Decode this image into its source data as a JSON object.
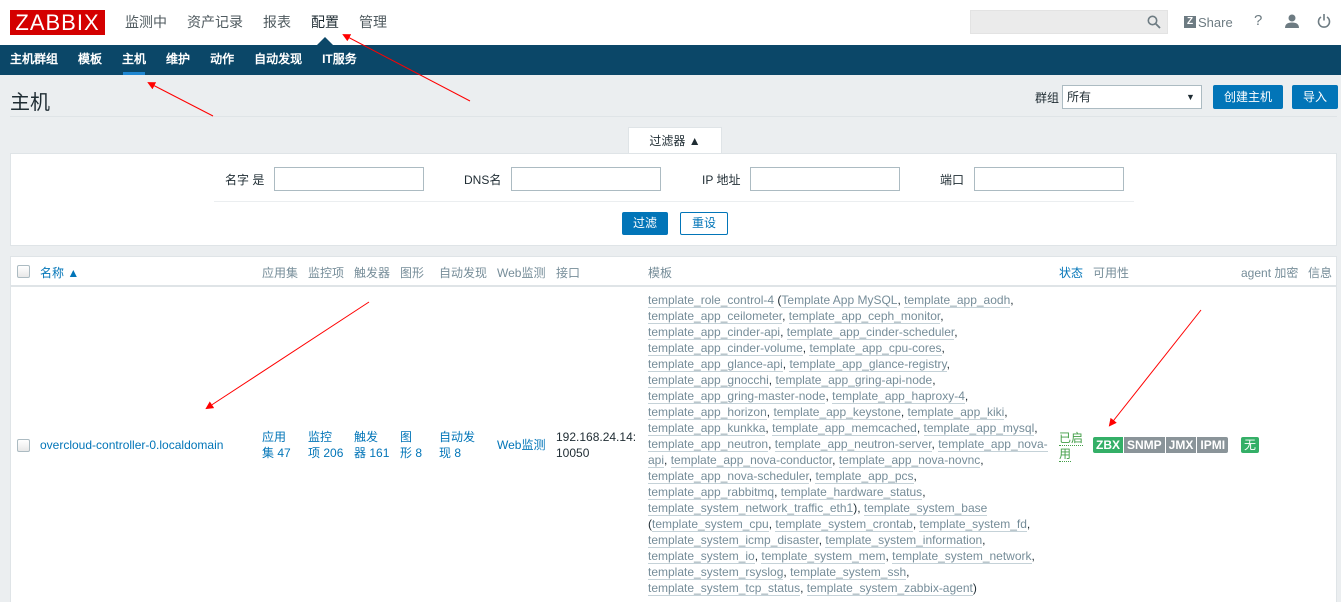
{
  "header": {
    "logo": "ZABBIX",
    "main_menu": [
      {
        "label": "监测中",
        "active": false
      },
      {
        "label": "资产记录",
        "active": false
      },
      {
        "label": "报表",
        "active": false
      },
      {
        "label": "配置",
        "active": true
      },
      {
        "label": "管理",
        "active": false
      }
    ],
    "search": {
      "value": "",
      "placeholder": ""
    },
    "share_label": "Share",
    "share_icon_letter": "Z",
    "help_label": "?"
  },
  "sub_menu": [
    {
      "label": "主机群组",
      "active": false
    },
    {
      "label": "模板",
      "active": false
    },
    {
      "label": "主机",
      "active": true
    },
    {
      "label": "维护",
      "active": false
    },
    {
      "label": "动作",
      "active": false
    },
    {
      "label": "自动发现",
      "active": false
    },
    {
      "label": "IT服务",
      "active": false
    }
  ],
  "page": {
    "title": "主机",
    "group_label": "群组",
    "group_selected": "所有",
    "group_arrow": "▼",
    "create_host_label": "创建主机",
    "import_label": "导入"
  },
  "filter": {
    "tab_label": "过滤器 ▲",
    "fields": [
      {
        "label": "名字 是",
        "value": ""
      },
      {
        "label": "DNS名",
        "value": ""
      },
      {
        "label": "IP 地址",
        "value": ""
      },
      {
        "label": "端口",
        "value": ""
      }
    ],
    "apply_label": "过滤",
    "reset_label": "重设"
  },
  "table": {
    "columns": {
      "name": "名称 ▲",
      "applications": "应用集",
      "items": "监控项",
      "triggers": "触发器",
      "graphs": "图形",
      "discovery": "自动发现",
      "web": "Web监测",
      "interface": "接口",
      "templates": "模板",
      "status": "状态",
      "availability": "可用性",
      "agent_encryption": "agent 加密",
      "info": "信息"
    },
    "rows": [
      {
        "name": "overcloud-controller-0.localdomain",
        "applications_label": "应用",
        "applications_label2": "集",
        "applications_count": "47",
        "items_label": "监控",
        "items_label2": "项",
        "items_count": "206",
        "triggers_label": "触发",
        "triggers_label2": "器",
        "triggers_count": "161",
        "graphs_label": "图",
        "graphs_label2": "形",
        "graphs_count": "8",
        "discovery_label": "自动发",
        "discovery_label2": "现",
        "discovery_count": "8",
        "web_label": "Web监测",
        "interface_line1": "192.168.24.14:",
        "interface_line2": "10050",
        "templates": [
          {
            "name": "template_role_control-4",
            "suffix": " ("
          },
          {
            "name": "Template App MySQL",
            "suffix": ", "
          },
          {
            "name": "template_app_aodh",
            "suffix": ", "
          },
          {
            "name": "template_app_ceilometer",
            "suffix": ", "
          },
          {
            "name": "template_app_ceph_monitor",
            "suffix": ", "
          },
          {
            "name": "template_app_cinder-api",
            "suffix": ", "
          },
          {
            "name": "template_app_cinder-scheduler",
            "suffix": ", "
          },
          {
            "name": "template_app_cinder-volume",
            "suffix": ", "
          },
          {
            "name": "template_app_cpu-cores",
            "suffix": ", "
          },
          {
            "name": "template_app_glance-api",
            "suffix": ", "
          },
          {
            "name": "template_app_glance-registry",
            "suffix": ", "
          },
          {
            "name": "template_app_gnocchi",
            "suffix": ", "
          },
          {
            "name": "template_app_gring-api-node",
            "suffix": ", "
          },
          {
            "name": "template_app_gring-master-node",
            "suffix": ", "
          },
          {
            "name": "template_app_haproxy-4",
            "suffix": ", "
          },
          {
            "name": "template_app_horizon",
            "suffix": ", "
          },
          {
            "name": "template_app_keystone",
            "suffix": ", "
          },
          {
            "name": "template_app_kiki",
            "suffix": ", "
          },
          {
            "name": "template_app_kunkka",
            "suffix": ", "
          },
          {
            "name": "template_app_memcached",
            "suffix": ", "
          },
          {
            "name": "template_app_mysql",
            "suffix": ", "
          },
          {
            "name": "template_app_neutron",
            "suffix": ", "
          },
          {
            "name": "template_app_neutron-server",
            "suffix": ", "
          },
          {
            "name": "template_app_nova-api",
            "suffix": ", "
          },
          {
            "name": "template_app_nova-conductor",
            "suffix": ", "
          },
          {
            "name": "template_app_nova-novnc",
            "suffix": ", "
          },
          {
            "name": "template_app_nova-scheduler",
            "suffix": ", "
          },
          {
            "name": "template_app_pcs",
            "suffix": ", "
          },
          {
            "name": "template_app_rabbitmq",
            "suffix": ", "
          },
          {
            "name": "template_hardware_status",
            "suffix": ", "
          },
          {
            "name": "template_system_network_traffic_eth1",
            "suffix": "), "
          },
          {
            "name": "template_system_base",
            "suffix": " ("
          },
          {
            "name": "template_system_cpu",
            "suffix": ", "
          },
          {
            "name": "template_system_crontab",
            "suffix": ", "
          },
          {
            "name": "template_system_fd",
            "suffix": ", "
          },
          {
            "name": "template_system_icmp_disaster",
            "suffix": ", "
          },
          {
            "name": "template_system_information",
            "suffix": ", "
          },
          {
            "name": "template_system_io",
            "suffix": ", "
          },
          {
            "name": "template_system_mem",
            "suffix": ", "
          },
          {
            "name": "template_system_network",
            "suffix": ", "
          },
          {
            "name": "template_system_rsyslog",
            "suffix": ", "
          },
          {
            "name": "template_system_ssh",
            "suffix": ", "
          },
          {
            "name": "template_system_tcp_status",
            "suffix": ", "
          },
          {
            "name": "template_system_zabbix-agent",
            "suffix": ")"
          }
        ],
        "status_line1": "已启",
        "status_line2": "用",
        "availability": [
          {
            "label": "ZBX",
            "state": "available"
          },
          {
            "label": "SNMP",
            "state": "unknown"
          },
          {
            "label": "JMX",
            "state": "unknown"
          },
          {
            "label": "IPMI",
            "state": "unknown"
          }
        ],
        "encryption": "无"
      }
    ]
  },
  "colors": {
    "brand_red": "#d40000",
    "nav_dark": "#0b4768",
    "accent_blue": "#0275b8",
    "status_green": "#429e47",
    "available_green": "#34af67",
    "unknown_gray": "#8a9499",
    "annotation_red": "#ff0000"
  }
}
